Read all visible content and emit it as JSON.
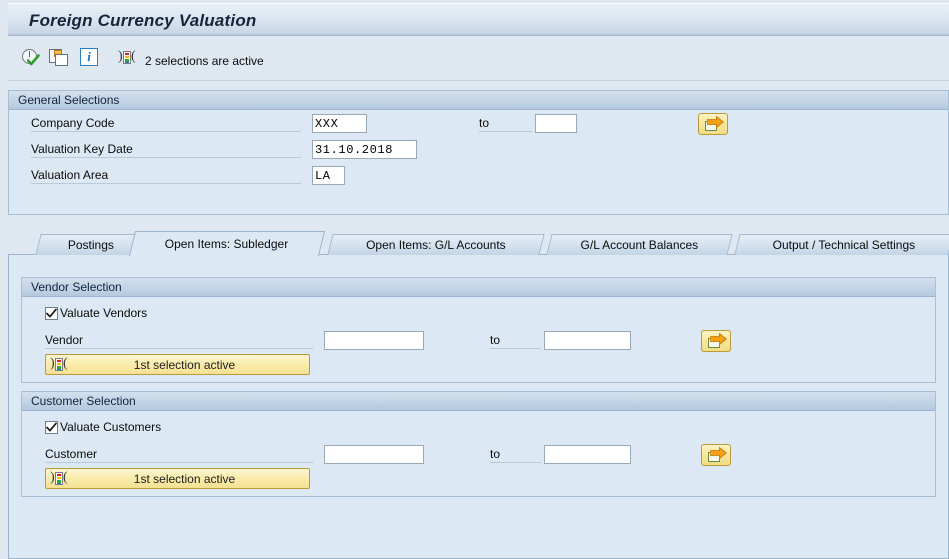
{
  "window": {
    "title": "Foreign Currency Valuation"
  },
  "toolbar": {
    "execute_icon": "execute-clock-check-icon",
    "copy_icon": "copy-variant-icon",
    "info_icon": "information-icon",
    "selection_icon": "multiple-selection-icon",
    "status_text": "2 selections are active"
  },
  "general_selections": {
    "panel_title": "General Selections",
    "fields": [
      {
        "label": "Company Code",
        "value": "XXX",
        "to_label": "to",
        "to_value": "",
        "has_multi_button": true,
        "multi_button_name": "multiple-selection-button-company-code"
      },
      {
        "label": "Valuation Key Date",
        "value": "31.10.2018",
        "to_label": "",
        "to_value": "",
        "has_multi_button": false
      },
      {
        "label": "Valuation Area",
        "value": "LA",
        "to_label": "",
        "to_value": "",
        "has_multi_button": false
      }
    ]
  },
  "tabs": [
    {
      "label": "Postings",
      "active": false
    },
    {
      "label": "Open Items: Subledger",
      "active": true
    },
    {
      "label": "Open Items: G/L Accounts",
      "active": false
    },
    {
      "label": "G/L Account Balances",
      "active": false
    },
    {
      "label": "Output / Technical Settings",
      "active": false
    }
  ],
  "vendor_selection": {
    "panel_title": "Vendor Selection",
    "checkbox_label": "Valuate Vendors",
    "checkbox_checked": true,
    "field_label": "Vendor",
    "field_value": "",
    "to_label": "to",
    "to_value": "",
    "selection_button_label": "1st selection active"
  },
  "customer_selection": {
    "panel_title": "Customer Selection",
    "checkbox_label": "Valuate Customers",
    "checkbox_checked": true,
    "field_label": "Customer",
    "field_value": "",
    "to_label": "to",
    "to_value": "",
    "selection_button_label": "1st selection active"
  },
  "colors": {
    "background": "#dfe7f0",
    "panel_bg": "#dce8f3",
    "panel_border": "#a8bed3",
    "title_text": "#15253c",
    "button_yellow": "#f7e79a",
    "button_yellow_border": "#b99a3c"
  }
}
